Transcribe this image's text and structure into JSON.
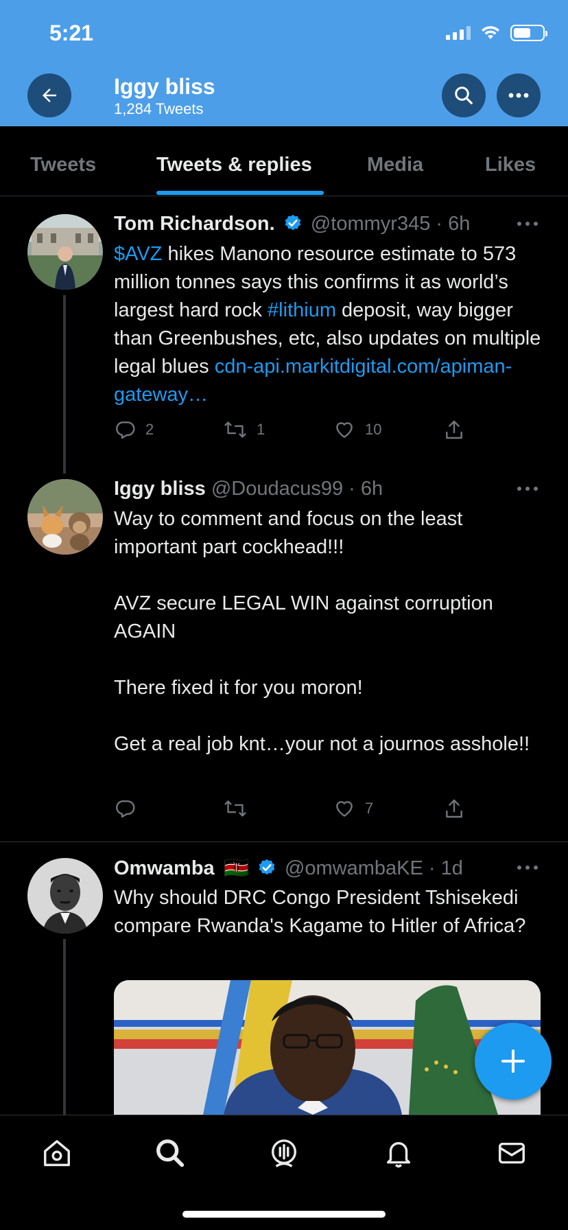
{
  "status_bar": {
    "time": "5:21"
  },
  "header": {
    "title": "Iggy bliss",
    "subtitle": "1,284 Tweets",
    "icons": [
      "back-arrow-icon",
      "search-icon",
      "more-icon"
    ],
    "color": "#4d9ee9"
  },
  "tabs": [
    {
      "label": "Tweets",
      "active": false
    },
    {
      "label": "Tweets & replies",
      "active": true
    },
    {
      "label": "Media",
      "active": false
    },
    {
      "label": "Likes",
      "active": false
    }
  ],
  "tweets": [
    {
      "name": "Tom Richardson.",
      "verified": true,
      "handle": "@tommyr345",
      "time": "6h",
      "body": {
        "cashtag": "$AVZ",
        "text1": " hikes Manono resource estimate to 573 million tonnes says this confirms it as world’s largest hard rock ",
        "hashtag": "#lithium",
        "text2": " deposit, way bigger than Greenbushes, etc, also updates on multiple legal blues ",
        "link": "cdn-api.markitdigital.com/apiman-gateway…"
      },
      "replies": "2",
      "retweets": "1",
      "likes": "10"
    },
    {
      "name": "Iggy bliss",
      "verified": false,
      "handle": "@Doudacus99",
      "time": "6h",
      "paragraphs": [
        "Way to comment and focus on the least important part cockhead!!!",
        "AVZ secure LEGAL WIN against corruption AGAIN",
        "There fixed it for you moron!",
        "Get a real job knt…your not a journos asshole!!"
      ],
      "replies": "",
      "retweets": "",
      "likes": "7"
    },
    {
      "name": "Omwamba",
      "flag": "🇰🇪",
      "verified": true,
      "handle": "@omwambaKE",
      "time": "1d",
      "text": "Why should DRC Congo President Tshisekedi compare Rwanda's Kagame to Hitler of Africa?"
    }
  ],
  "bottom_nav": [
    "home-icon",
    "search-icon",
    "spaces-icon",
    "notifications-icon",
    "messages-icon"
  ],
  "accent_color": "#1d9bf0"
}
